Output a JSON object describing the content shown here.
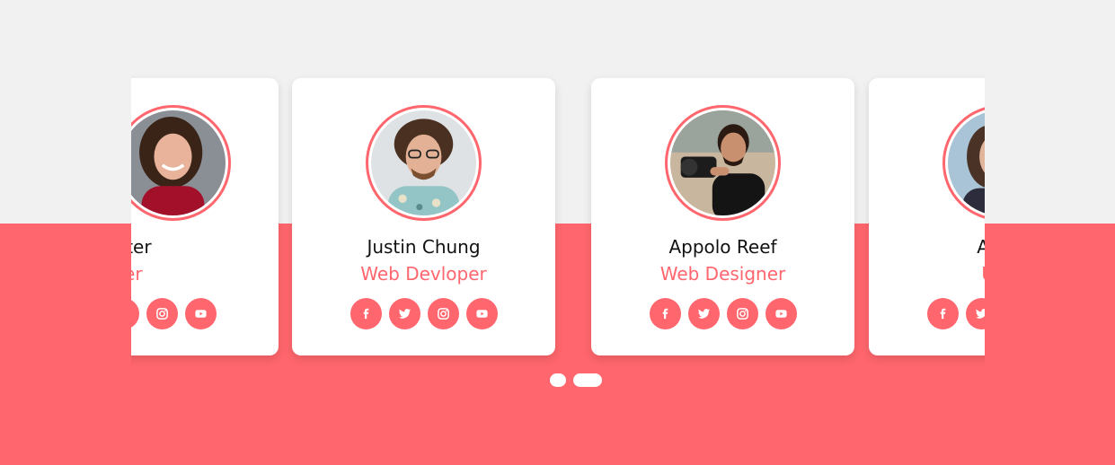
{
  "colors": {
    "accent": "#ff666d",
    "background_top": "#f1f1f1",
    "card": "#ffffff"
  },
  "cards": [
    {
      "name": "ne Carter",
      "role": "esigner",
      "avatar": "woman-red-top"
    },
    {
      "name": "Justin Chung",
      "role": "Web Devloper",
      "avatar": "curly-hair-glasses-man"
    },
    {
      "name": "Appolo Reef",
      "role": "Web Designer",
      "avatar": "photographer-man"
    },
    {
      "name": "Adrin",
      "role": "UI D",
      "avatar": "woman-blue-background"
    }
  ],
  "social_icons": [
    "facebook-icon",
    "twitter-icon",
    "instagram-icon",
    "youtube-icon"
  ],
  "pagination": {
    "pages": 2,
    "active": 2
  }
}
